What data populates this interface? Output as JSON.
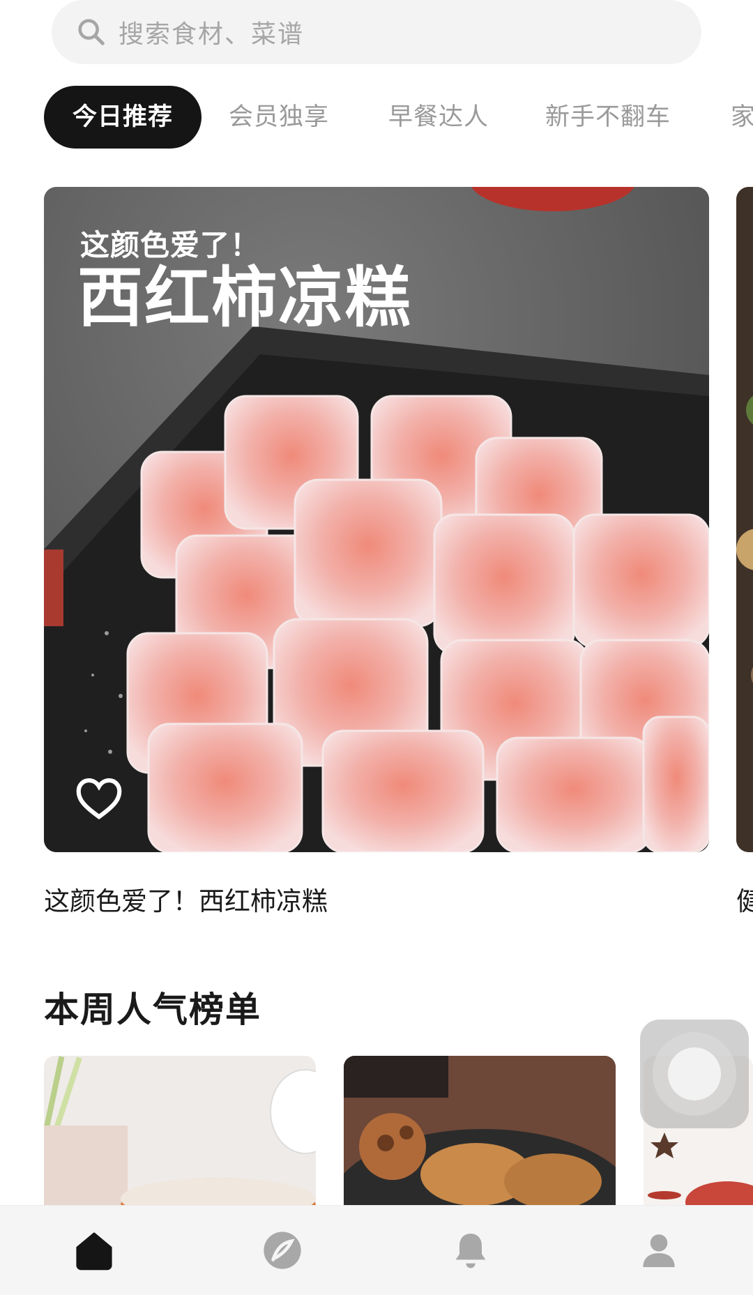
{
  "search": {
    "placeholder": "搜索食材、菜谱"
  },
  "tabs": [
    {
      "label": "今日推荐",
      "active": true
    },
    {
      "label": "会员独享",
      "active": false
    },
    {
      "label": "早餐达人",
      "active": false
    },
    {
      "label": "新手不翻车",
      "active": false
    },
    {
      "label": "家",
      "active": false
    }
  ],
  "hero": {
    "overline": "这颜色爱了！",
    "title": "西红柿凉糕",
    "caption": "这颜色爱了！西红柿凉糕",
    "favorited": false
  },
  "peek": {
    "caption": "健"
  },
  "section": {
    "title": "本周人气榜单"
  },
  "nav": {
    "items": [
      {
        "icon": "home-icon",
        "active": true
      },
      {
        "icon": "discover-icon",
        "active": false
      },
      {
        "icon": "bell-icon",
        "active": false
      },
      {
        "icon": "profile-icon",
        "active": false
      }
    ]
  },
  "colors": {
    "accent": "#151515",
    "inactive_icon": "#a8a8a8",
    "tab_inactive": "#9a9a9a"
  }
}
